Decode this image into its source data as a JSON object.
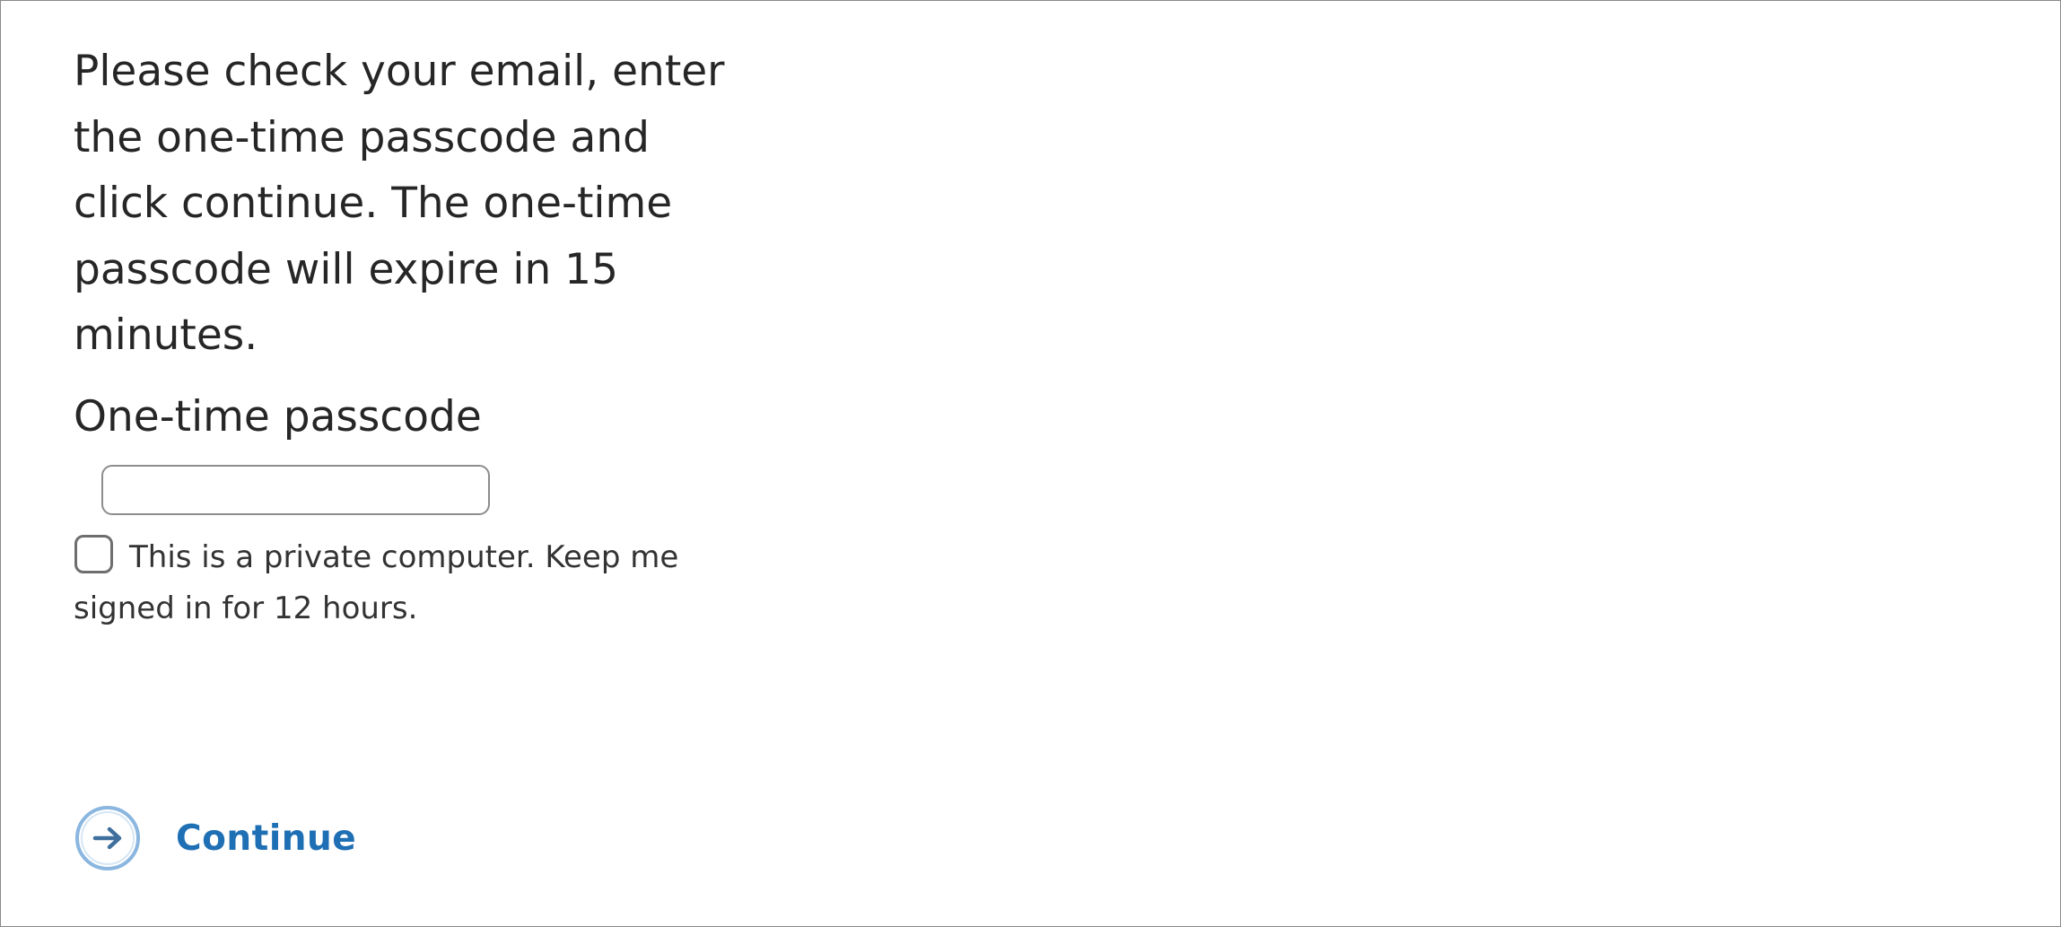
{
  "instructions": "Please check your email, enter the one-time passcode and click continue. The one-time passcode will expire in 15 minutes.",
  "passcode": {
    "label": "One-time passcode",
    "value": "",
    "placeholder": ""
  },
  "keep_signed_in": {
    "label": "This is a private computer. Keep me signed in for 12 hours.",
    "checked": false
  },
  "continue": {
    "label": "Continue",
    "icon": "arrow-right-circle-icon"
  },
  "colors": {
    "accent": "#1f6fb5",
    "icon_ring": "#8ab6df",
    "text": "#262626",
    "border": "#8c8c8c"
  }
}
